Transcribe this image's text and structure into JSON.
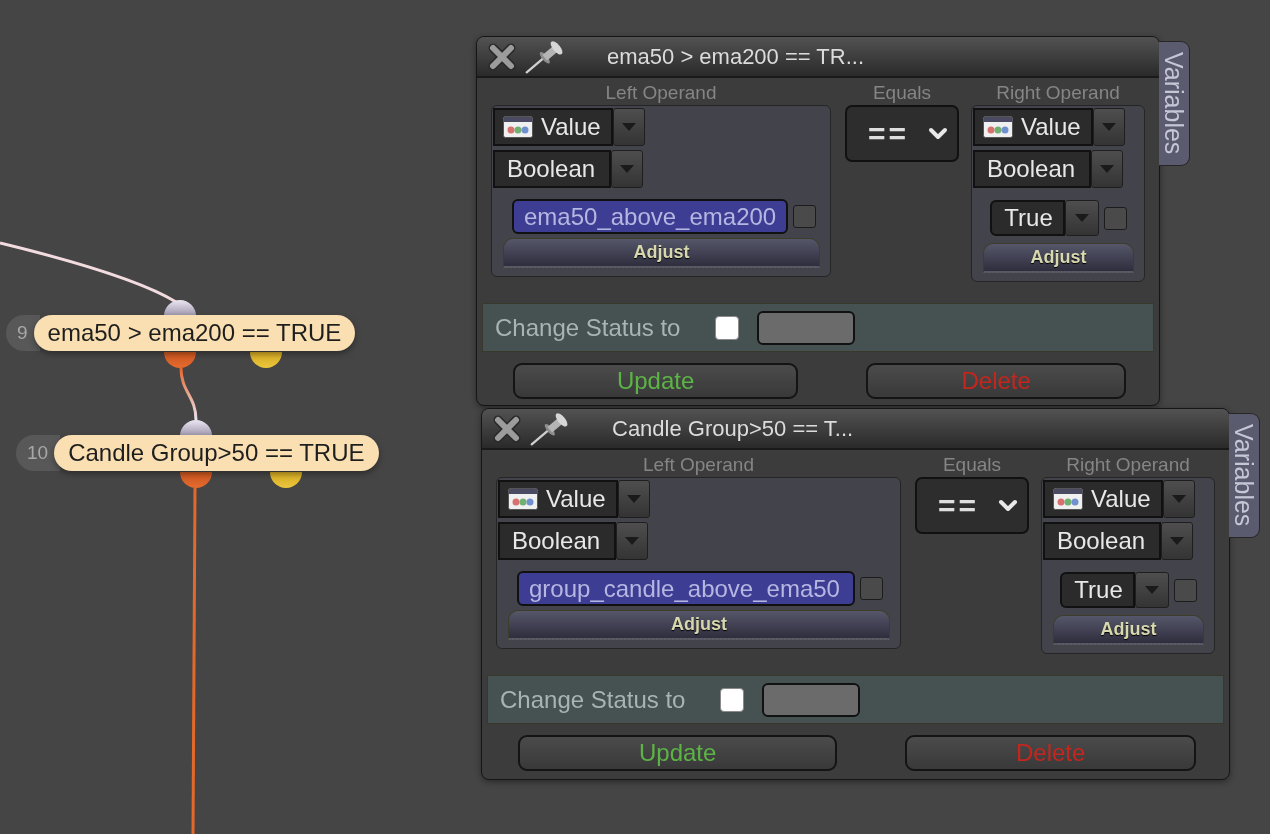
{
  "canvas": {
    "nodes": [
      {
        "number": "9",
        "label": "ema50 > ema200 == TRUE"
      },
      {
        "number": "10",
        "label": "Candle Group>50 == TRUE"
      }
    ]
  },
  "windows": [
    {
      "title": "ema50 > ema200 == TR...",
      "side_tab": "Variables",
      "left_operand": {
        "heading": "Left Operand",
        "source": "Value",
        "type": "Boolean",
        "value": {
          "kind": "variable",
          "text": "ema50_above_ema200"
        },
        "checked": false,
        "button": "Adjust"
      },
      "operator": {
        "heading": "Equals",
        "value": "=="
      },
      "right_operand": {
        "heading": "Right Operand",
        "source": "Value",
        "type": "Boolean",
        "value": {
          "kind": "constant",
          "text": "True"
        },
        "checked": false,
        "button": "Adjust"
      },
      "change_status": {
        "label": "Change Status to",
        "checked": false
      },
      "buttons": [
        {
          "label": "Update",
          "kind": "update"
        },
        {
          "label": "Delete",
          "kind": "delete"
        }
      ]
    },
    {
      "title": "Candle Group>50 == T...",
      "side_tab": "Variables",
      "left_operand": {
        "heading": "Left Operand",
        "source": "Value",
        "type": "Boolean",
        "value": {
          "kind": "variable",
          "text": "group_candle_above_ema50"
        },
        "checked": false,
        "button": "Adjust"
      },
      "operator": {
        "heading": "Equals",
        "value": "=="
      },
      "right_operand": {
        "heading": "Right Operand",
        "source": "Value",
        "type": "Boolean",
        "value": {
          "kind": "constant",
          "text": "True"
        },
        "checked": false,
        "button": "Adjust"
      },
      "change_status": {
        "label": "Change Status to",
        "checked": false
      },
      "buttons": [
        {
          "label": "Update",
          "kind": "update"
        },
        {
          "label": "Delete",
          "kind": "delete"
        }
      ]
    }
  ]
}
